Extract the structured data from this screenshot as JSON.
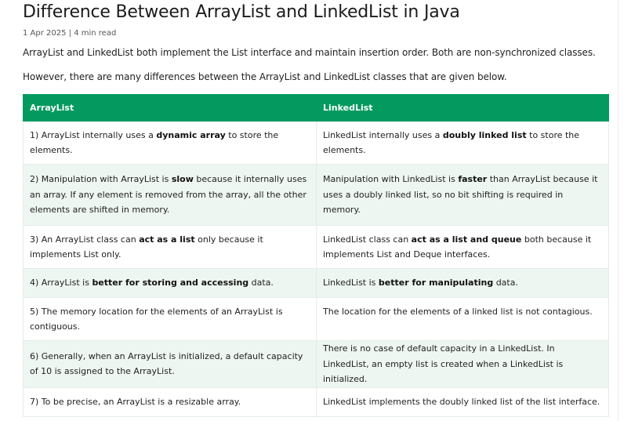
{
  "article": {
    "title": "Difference Between ArrayList and LinkedList in Java",
    "date": "1 Apr 2025",
    "separator": " | ",
    "read_time": "4 min read",
    "intro": "ArrayList and LinkedList both implement the List interface and maintain insertion order. Both are non-synchronized classes.",
    "lead": "However, there are many differences between the ArrayList and LinkedList classes that are given below."
  },
  "table": {
    "headers": [
      "ArrayList",
      "LinkedList"
    ],
    "rows": [
      {
        "left": {
          "pre": "1) ArrayList internally uses a ",
          "bold": "dynamic array",
          "post": " to store the elements."
        },
        "right": {
          "pre": "LinkedList internally uses a ",
          "bold": "doubly linked list",
          "post": " to store the elements."
        }
      },
      {
        "left": {
          "pre": "2) Manipulation with ArrayList is ",
          "bold": "slow",
          "post": " because it internally uses an array. If any element is removed from the array, all the other elements are shifted in memory."
        },
        "right": {
          "pre": "Manipulation with LinkedList is ",
          "bold": "faster",
          "post": " than ArrayList because it uses a doubly linked list, so no bit shifting is required in memory."
        }
      },
      {
        "left": {
          "pre": "3) An ArrayList class can ",
          "bold": "act as a list",
          "post": " only because it implements List only."
        },
        "right": {
          "pre": "LinkedList class can ",
          "bold": "act as a list and queue",
          "post": " both because it implements List and Deque interfaces."
        }
      },
      {
        "left": {
          "pre": "4) ArrayList is ",
          "bold": "better for storing and accessing",
          "post": " data."
        },
        "right": {
          "pre": "LinkedList is ",
          "bold": "better for manipulating",
          "post": " data."
        }
      },
      {
        "left": {
          "pre": "5) The memory location for the elements of an ArrayList is contiguous.",
          "bold": "",
          "post": ""
        },
        "right": {
          "pre": "The location for the elements of a linked list is not contagious.",
          "bold": "",
          "post": ""
        }
      },
      {
        "left": {
          "pre": "6) Generally, when an ArrayList is initialized, a default capacity of 10 is assigned to the ArrayList.",
          "bold": "",
          "post": ""
        },
        "right": {
          "pre": "There is no case of default capacity in a LinkedList. In LinkedList, an empty list is created when a LinkedList is initialized.",
          "bold": "",
          "post": ""
        }
      },
      {
        "left": {
          "pre": "7) To be precise, an ArrayList is a resizable array.",
          "bold": "",
          "post": ""
        },
        "right": {
          "pre": "LinkedList implements the doubly linked list of the list interface.",
          "bold": "",
          "post": ""
        }
      }
    ]
  }
}
